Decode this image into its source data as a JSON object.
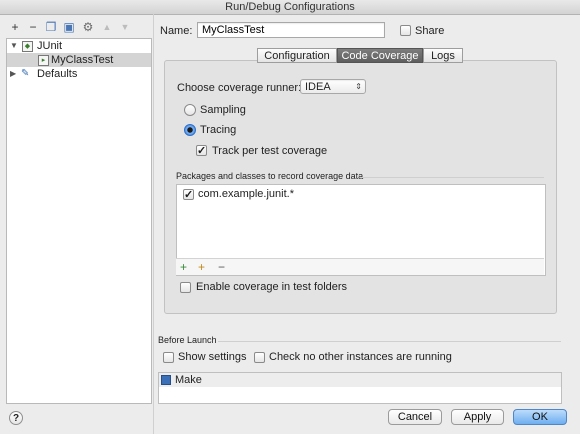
{
  "window": {
    "title": "Run/Debug Configurations"
  },
  "toolbar": {
    "add": "+",
    "remove": "−",
    "copy": "❐",
    "save": "▣",
    "edit_defaults": "⚙",
    "move_up": "▲",
    "move_down": "▼"
  },
  "tree": {
    "items": [
      {
        "label": "JUnit",
        "expanded": true
      },
      {
        "label": "MyClassTest",
        "selected": true
      },
      {
        "label": "Defaults",
        "expanded": false
      }
    ]
  },
  "name_field": {
    "label": "Name:",
    "value": "MyClassTest"
  },
  "share": {
    "label": "Share",
    "checked": false
  },
  "tabs": [
    {
      "label": "Configuration",
      "active": false
    },
    {
      "label": "Code Coverage",
      "active": true
    },
    {
      "label": "Logs",
      "active": false
    }
  ],
  "coverage": {
    "runner_label": "Choose coverage runner:",
    "runner_value": "IDEA",
    "sampling_label": "Sampling",
    "tracing_label": "Tracing",
    "selected_mode": "Tracing",
    "track_per_test_label": "Track per test coverage",
    "track_per_test_checked": true,
    "packages_label": "Packages and classes to record coverage data",
    "packages": [
      {
        "pattern": "com.example.junit.*",
        "checked": true
      }
    ],
    "add_class_icon": "+",
    "add_package_icon": "+",
    "remove_icon": "−",
    "test_folders_label": "Enable coverage in test folders",
    "test_folders_checked": false
  },
  "before_launch": {
    "label": "Before Launch",
    "show_settings_label": "Show settings",
    "show_settings_checked": false,
    "single_instance_label": "Check no other instances are running",
    "single_instance_checked": false,
    "tasks": [
      {
        "label": "Make"
      }
    ]
  },
  "buttons": {
    "help": "?",
    "cancel": "Cancel",
    "apply": "Apply",
    "ok": "OK"
  },
  "colors": {
    "accent": "#3d87e6",
    "default_button": "#6eaef0",
    "active_tab": "#6a6a6a"
  }
}
